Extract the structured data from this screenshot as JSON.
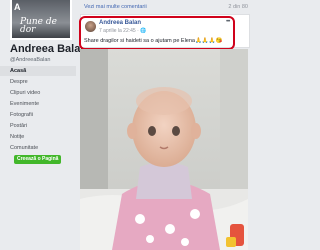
{
  "profile": {
    "monogram": "A",
    "cover_text": "Pune de dor",
    "name": "Andreea Balan",
    "handle": "@AndreeaBalan"
  },
  "nav": {
    "items": [
      {
        "label": "Acasă",
        "active": true
      },
      {
        "label": "Despre",
        "active": false
      },
      {
        "label": "Clipuri video",
        "active": false
      },
      {
        "label": "Evenimente",
        "active": false
      },
      {
        "label": "Fotografii",
        "active": false
      },
      {
        "label": "Postări",
        "active": false
      },
      {
        "label": "Notițe",
        "active": false
      },
      {
        "label": "Comunitate",
        "active": false
      }
    ],
    "create_page": "Creează o Pagină"
  },
  "topbar": {
    "more_comments": "Vezi mai multe comentarii",
    "count": "2 din 80"
  },
  "post": {
    "author": "Andreea Balan",
    "timestamp": "7 aprilie la 22:45 · 🌐",
    "text": "Share dragilor si haideti sa o ajutam pe Elena🙏🙏🙏😘"
  },
  "colors": {
    "highlight": "#d0021b",
    "link": "#385898",
    "create_button": "#42b72a"
  }
}
